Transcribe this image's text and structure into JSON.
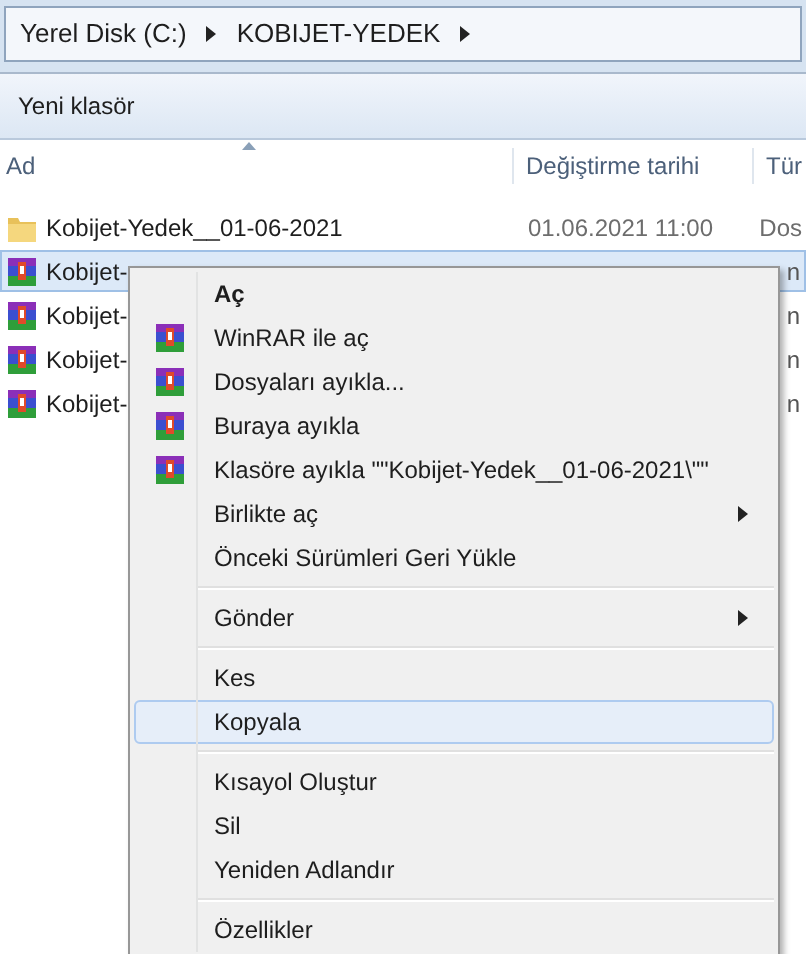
{
  "address_bar": {
    "crumbs": [
      "Yerel Disk (C:)",
      "KOBIJET-YEDEK"
    ]
  },
  "toolbar": {
    "buttons": [
      "Yeni klasör"
    ]
  },
  "columns": [
    "Ad",
    "Değiştirme tarihi",
    "Tür"
  ],
  "rows": [
    {
      "kind": "folder",
      "name": "Kobijet-Yedek__01-06-2021",
      "date": "01.06.2021 11:00",
      "type": "Dos",
      "selected": false
    },
    {
      "kind": "archive",
      "name": "Kobijet-",
      "type": "n",
      "selected": true
    },
    {
      "kind": "archive",
      "name": "Kobijet-",
      "type": "n",
      "selected": false
    },
    {
      "kind": "archive",
      "name": "Kobijet-",
      "type": "n",
      "selected": false
    },
    {
      "kind": "archive",
      "name": "Kobijet-",
      "type": "n",
      "selected": false
    }
  ],
  "context_menu": [
    {
      "kind": "item",
      "label": "Aç",
      "bold": true,
      "icon": false,
      "submenu": false,
      "selected": false
    },
    {
      "kind": "item",
      "label": "WinRAR ile aç",
      "bold": false,
      "icon": true,
      "submenu": false,
      "selected": false
    },
    {
      "kind": "item",
      "label": "Dosyaları ayıkla...",
      "bold": false,
      "icon": true,
      "submenu": false,
      "selected": false
    },
    {
      "kind": "item",
      "label": "Buraya ayıkla",
      "bold": false,
      "icon": true,
      "submenu": false,
      "selected": false
    },
    {
      "kind": "item",
      "label": "Klasöre ayıkla \"\"Kobijet-Yedek__01-06-2021\\\"\"",
      "bold": false,
      "icon": true,
      "submenu": false,
      "selected": false
    },
    {
      "kind": "item",
      "label": "Birlikte aç",
      "bold": false,
      "icon": false,
      "submenu": true,
      "selected": false
    },
    {
      "kind": "item",
      "label": "Önceki Sürümleri Geri Yükle",
      "bold": false,
      "icon": false,
      "submenu": false,
      "selected": false
    },
    {
      "kind": "separator"
    },
    {
      "kind": "item",
      "label": "Gönder",
      "bold": false,
      "icon": false,
      "submenu": true,
      "selected": false
    },
    {
      "kind": "separator"
    },
    {
      "kind": "item",
      "label": "Kes",
      "bold": false,
      "icon": false,
      "submenu": false,
      "selected": false
    },
    {
      "kind": "item",
      "label": "Kopyala",
      "bold": false,
      "icon": false,
      "submenu": false,
      "selected": true
    },
    {
      "kind": "separator"
    },
    {
      "kind": "item",
      "label": "Kısayol Oluştur",
      "bold": false,
      "icon": false,
      "submenu": false,
      "selected": false
    },
    {
      "kind": "item",
      "label": "Sil",
      "bold": false,
      "icon": false,
      "submenu": false,
      "selected": false
    },
    {
      "kind": "item",
      "label": "Yeniden Adlandır",
      "bold": false,
      "icon": false,
      "submenu": false,
      "selected": false
    },
    {
      "kind": "separator"
    },
    {
      "kind": "item",
      "label": "Özellikler",
      "bold": false,
      "icon": false,
      "submenu": false,
      "selected": false
    }
  ]
}
